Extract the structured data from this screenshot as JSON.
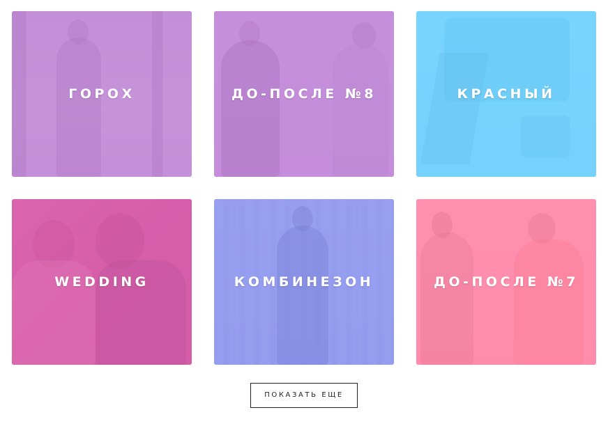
{
  "gallery": {
    "items": [
      {
        "title": "ГОРОХ"
      },
      {
        "title": "ДО-ПОСЛЕ №8"
      },
      {
        "title": "КРАСНЫЙ"
      },
      {
        "title": "WEDDING"
      },
      {
        "title": "КОМБИНЕЗОН"
      },
      {
        "title": "ДО-ПОСЛЕ №7"
      }
    ]
  },
  "actions": {
    "show_more_label": "ПОКАЗАТЬ ЕЩЕ"
  },
  "colors": {
    "overlay_purple": "#c184d8",
    "overlay_blue": "#6fd2ff",
    "overlay_pink": "#d85aa8",
    "overlay_indigo": "#8d95ee",
    "overlay_rose": "#ff86a8"
  }
}
